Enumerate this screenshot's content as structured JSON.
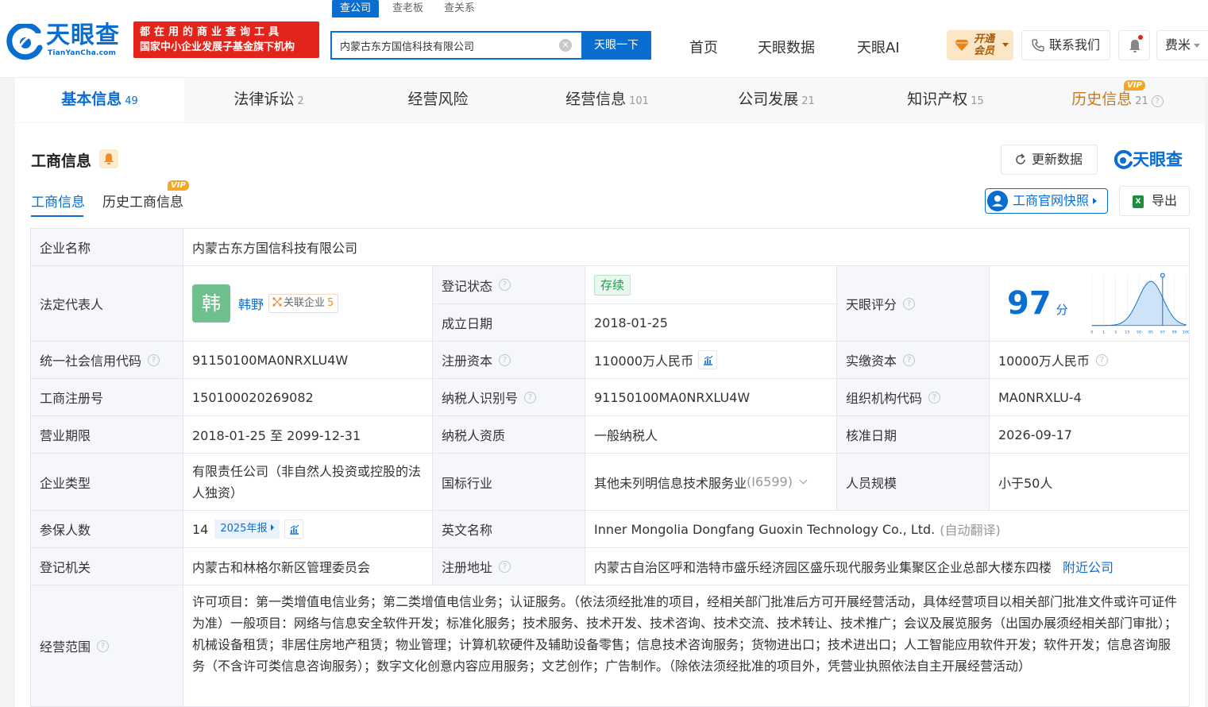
{
  "brand": {
    "logo_text": "天眼查",
    "logo_sub": "TianYanCha.com",
    "banner_line1": "都在用的商业查询工具",
    "banner_line2": "国家中小企业发展子基金旗下机构"
  },
  "search": {
    "tabs": [
      "查公司",
      "查老板",
      "查关系"
    ],
    "value": "内蒙古东方国信科技有限公司",
    "button": "天眼一下"
  },
  "nav": {
    "links": [
      "首页",
      "天眼数据",
      "天眼AI"
    ],
    "vip_line1": "开通",
    "vip_line2": "会员",
    "contact": "联系我们",
    "user": "费米"
  },
  "main_tabs": [
    {
      "label": "基本信息",
      "count": "49"
    },
    {
      "label": "法律诉讼",
      "count": "2"
    },
    {
      "label": "经营风险",
      "count": ""
    },
    {
      "label": "经营信息",
      "count": "101"
    },
    {
      "label": "公司发展",
      "count": "21"
    },
    {
      "label": "知识产权",
      "count": "15"
    },
    {
      "label": "历史信息",
      "count": "21"
    }
  ],
  "vip_tag": "VIP",
  "section": {
    "title": "工商信息",
    "refresh": "更新数据",
    "brand_mini": "天眼查",
    "sub_tabs": [
      "工商信息",
      "历史工商信息"
    ],
    "snapshot": "工商官网快照",
    "export": "导出"
  },
  "info": {
    "company_name_label": "企业名称",
    "company_name": "内蒙古东方国信科技有限公司",
    "legal_rep_label": "法定代表人",
    "legal_rep_avatar": "韩",
    "legal_rep_name": "韩野",
    "related_label": "关联企业",
    "related_count": "5",
    "reg_status_label": "登记状态",
    "reg_status": "存续",
    "found_date_label": "成立日期",
    "found_date": "2018-01-25",
    "score_label": "天眼评分",
    "score": "97",
    "score_unit": "分",
    "score_axis": [
      "0",
      "1",
      "3",
      "15",
      "50",
      "85",
      "97",
      "99",
      "100"
    ],
    "credit_code_label": "统一社会信用代码",
    "credit_code": "91150100MA0NRXLU4W",
    "reg_capital_label": "注册资本",
    "reg_capital": "110000万人民币",
    "paid_capital_label": "实缴资本",
    "paid_capital": "10000万人民币",
    "reg_no_label": "工商注册号",
    "reg_no": "150100020269082",
    "taxpayer_id_label": "纳税人识别号",
    "taxpayer_id": "91150100MA0NRXLU4W",
    "org_code_label": "组织机构代码",
    "org_code": "MA0NRXLU-4",
    "term_label": "营业期限",
    "term": "2018-01-25 至 2099-12-31",
    "tax_qual_label": "纳税人资质",
    "tax_qual": "一般纳税人",
    "approve_date_label": "核准日期",
    "approve_date": "2026-09-17",
    "type_label": "企业类型",
    "type": "有限责任公司（非自然人投资或控股的法人独资）",
    "industry_label": "国标行业",
    "industry": "其他未列明信息技术服务业",
    "industry_code": "(I6599)",
    "staff_label": "人员规模",
    "staff": "小于50人",
    "insured_label": "参保人数",
    "insured": "14",
    "insured_report": "2025年报",
    "english_label": "英文名称",
    "english": "Inner Mongolia Dongfang Guoxin Technology Co., Ltd.",
    "english_note": "(自动翻译)",
    "authority_label": "登记机关",
    "authority": "内蒙古和林格尔新区管理委员会",
    "address_label": "注册地址",
    "address": "内蒙古自治区呼和浩特市盛乐经济园区盛乐现代服务业集聚区企业总部大楼东四楼",
    "nearby": "附近公司",
    "scope_label": "经营范围",
    "scope": "许可项目：第一类增值电信业务；第二类增值电信业务；认证服务。（依法须经批准的项目，经相关部门批准后方可开展经营活动，具体经营项目以相关部门批准文件或许可证件为准）一般项目：网络与信息安全软件开发；标准化服务；技术服务、技术开发、技术咨询、技术交流、技术转让、技术推广；会议及展览服务（出国办展须经相关部门审批）；机械设备租赁；非居住房地产租赁；物业管理；计算机软硬件及辅助设备零售；信息技术咨询服务；货物进出口；技术进出口；人工智能应用软件开发；软件开发；信息咨询服务（不含许可类信息咨询服务）；数字文化创意内容应用服务；文艺创作；广告制作。（除依法须经批准的项目外，凭营业执照依法自主开展经营活动）"
  },
  "colors": {
    "primary": "#0a6ed1",
    "brand_red": "#e2241a",
    "status_green": "#1c9e4b",
    "vip_gold": "#c8781e"
  }
}
